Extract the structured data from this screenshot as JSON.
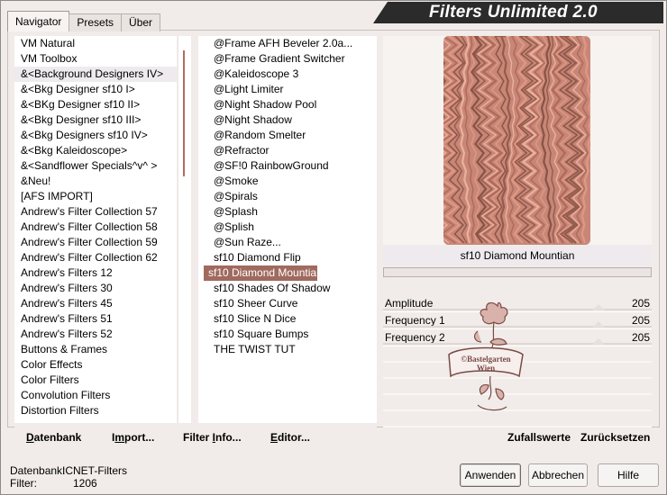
{
  "tabs": [
    {
      "label": "Navigator"
    },
    {
      "label": "Presets"
    },
    {
      "label": "Über"
    }
  ],
  "title": "Filters Unlimited 2.0",
  "categories": [
    "VM Natural",
    "VM Toolbox",
    "&<Background Designers IV>",
    "&<Bkg Designer sf10 I>",
    "&<BKg Designer sf10 II>",
    "&<Bkg Designer sf10 III>",
    "&<Bkg Designers sf10 IV>",
    "&<Bkg Kaleidoscope>",
    "&<Sandflower Specials^v^ >",
    "&Neu!",
    "[AFS IMPORT]",
    "Andrew's Filter Collection 57",
    "Andrew's Filter Collection 58",
    "Andrew's Filter Collection 59",
    "Andrew's Filter Collection 62",
    "Andrew's Filters 12",
    "Andrew's Filters 30",
    "Andrew's Filters 45",
    "Andrew's Filters 51",
    "Andrew's Filters 52",
    "Buttons & Frames",
    "Color Effects",
    "Color Filters",
    "Convolution Filters",
    "Distortion Filters"
  ],
  "filters": [
    "@Frame AFH Beveler 2.0a...",
    "@Frame Gradient Switcher",
    "@Kaleidoscope 3",
    "@Light Limiter",
    "@Night Shadow Pool",
    "@Night Shadow",
    "@Random Smelter",
    "@Refractor",
    "@SF!0 RainbowGround",
    "@Smoke",
    "@Spirals",
    "@Splash",
    "@Splish",
    "@Sun Raze...",
    "sf10 Diamond Flip",
    "sf10 Diamond Mountian",
    "sf10 Shades Of Shadow",
    "sf10 Sheer Curve",
    "sf10 Slice N Dice",
    "sf10 Square Bumps",
    "THE TWIST TUT"
  ],
  "selected_filter": "sf10 Diamond Mountian",
  "params": [
    {
      "label": "Amplitude",
      "value": "205"
    },
    {
      "label": "Frequency 1",
      "value": "205"
    },
    {
      "label": "Frequency 2",
      "value": "205"
    }
  ],
  "watermark_text": [
    "©Bastelgarten",
    "Wien"
  ],
  "buttons": {
    "datenbank_u": "D",
    "datenbank_rest": "atenbank",
    "import_a": "I",
    "import_u": "m",
    "import_rest": "port...",
    "filterinfo_a": "Filter ",
    "filterinfo_u": "I",
    "filterinfo_rest": "nfo...",
    "editor_u": "E",
    "editor_rest": "ditor...",
    "zufall": "Zufallswerte",
    "reset": "Zurücksetzen",
    "anwenden": "Anwenden",
    "abbrechen": "Abbrechen",
    "hilfe": "Hilfe"
  },
  "status": {
    "db_label": "Datenbank:",
    "db_value": "ICNET-Filters",
    "filter_label": "Filter:",
    "filter_value": "1206"
  },
  "colors": {
    "accent": "#a06a5f",
    "preview_base": "#c88676",
    "scroll_thumb": "#b46b62"
  }
}
